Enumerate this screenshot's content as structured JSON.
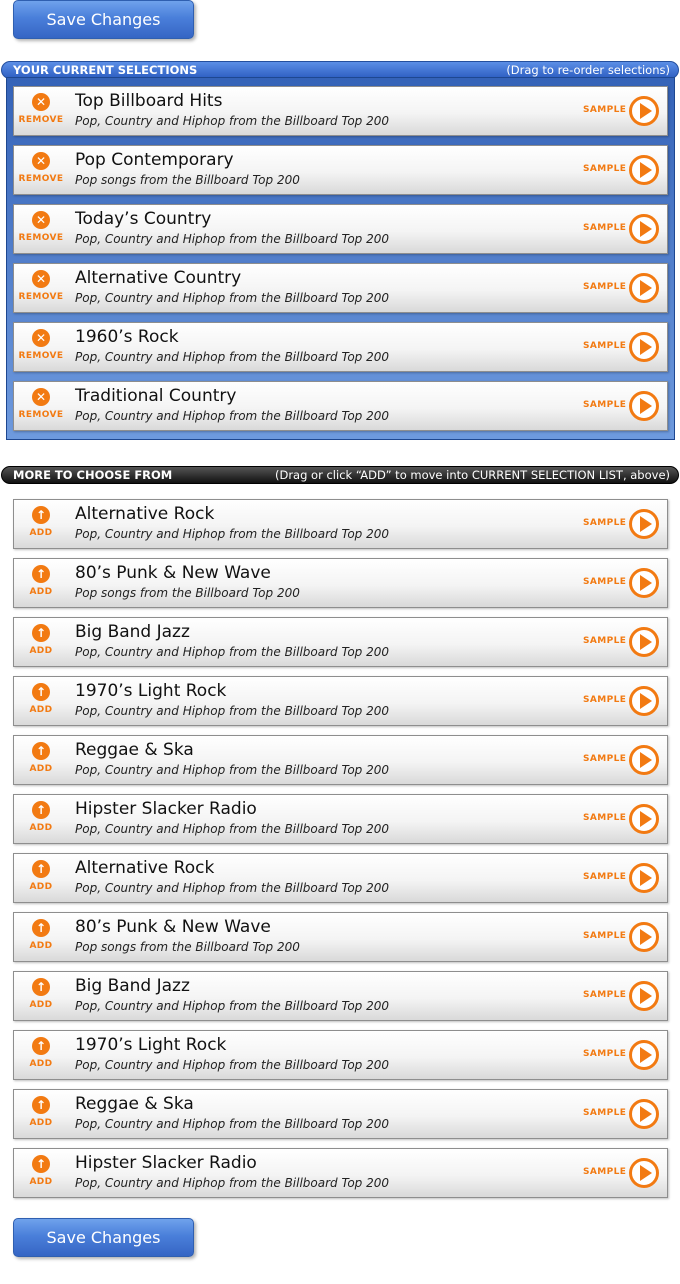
{
  "save_button": {
    "label": "Save Changes"
  },
  "current_section": {
    "title": "YOUR CURRENT SELECTIONS",
    "hint": "(Drag  to re-order selections)",
    "action_label": "REMOVE",
    "sample_label": "SAMPLE",
    "items": [
      {
        "name": "Top Billboard Hits",
        "desc": "Pop, Country and Hiphop from the Billboard Top 200"
      },
      {
        "name": "Pop Contemporary",
        "desc": "Pop songs from the Billboard Top 200"
      },
      {
        "name": "Today’s Country",
        "desc": "Pop, Country and Hiphop from the Billboard Top 200"
      },
      {
        "name": "Alternative Country",
        "desc": "Pop, Country and Hiphop from the Billboard Top 200"
      },
      {
        "name": "1960’s Rock",
        "desc": "Pop, Country and Hiphop from the Billboard Top 200"
      },
      {
        "name": "Traditional Country",
        "desc": "Pop, Country and Hiphop from the Billboard Top 200"
      }
    ]
  },
  "more_section": {
    "title": "MORE TO CHOOSE FROM",
    "hint": "(Drag or click “ADD” to move into CURRENT SELECTION LIST, above)",
    "action_label": "ADD",
    "sample_label": "SAMPLE",
    "items": [
      {
        "name": "Alternative Rock",
        "desc": "Pop, Country and Hiphop from the Billboard Top 200"
      },
      {
        "name": "80’s Punk & New Wave",
        "desc": "Pop songs from the Billboard Top 200"
      },
      {
        "name": "Big Band Jazz",
        "desc": "Pop, Country and Hiphop from the Billboard Top 200"
      },
      {
        "name": "1970’s Light Rock",
        "desc": "Pop, Country and Hiphop from the Billboard Top 200"
      },
      {
        "name": "Reggae & Ska",
        "desc": "Pop, Country and Hiphop from the Billboard Top 200"
      },
      {
        "name": "Hipster Slacker Radio",
        "desc": "Pop, Country and Hiphop from the Billboard Top 200"
      },
      {
        "name": "Alternative Rock",
        "desc": "Pop, Country and Hiphop from the Billboard Top 200"
      },
      {
        "name": "80’s Punk & New Wave",
        "desc": "Pop songs from the Billboard Top 200"
      },
      {
        "name": "Big Band Jazz",
        "desc": "Pop, Country and Hiphop from the Billboard Top 200"
      },
      {
        "name": "1970’s Light Rock",
        "desc": "Pop, Country and Hiphop from the Billboard Top 200"
      },
      {
        "name": "Reggae & Ska",
        "desc": "Pop, Country and Hiphop from the Billboard Top 200"
      },
      {
        "name": "Hipster Slacker Radio",
        "desc": "Pop, Country and Hiphop from the Billboard Top 200"
      }
    ]
  },
  "colors": {
    "accent_orange": "#f27a12",
    "primary_blue": "#3565c4",
    "dark_bar": "#111111"
  },
  "icons": {
    "remove": "remove-circle-x-icon",
    "add": "add-circle-up-arrow-icon",
    "sample": "play-circle-icon"
  }
}
